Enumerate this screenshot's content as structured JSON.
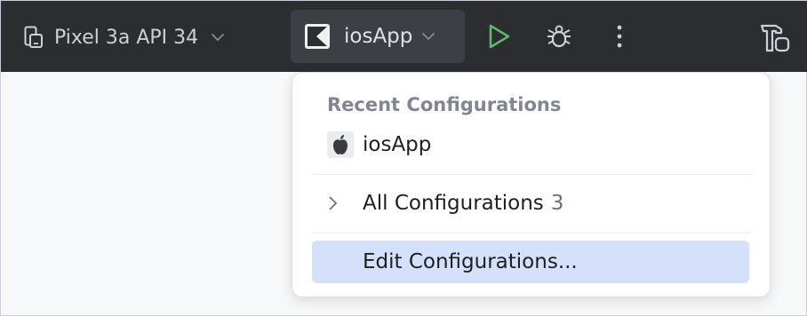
{
  "toolbar": {
    "device": {
      "label": "Pixel 3a API 34",
      "icon": "device-icon",
      "dropdown_icon": "chevron-down-icon"
    },
    "run_config": {
      "label": "iosApp",
      "icon": "kotlin-multiplatform-icon",
      "dropdown_icon": "chevron-down-icon"
    },
    "actions": [
      {
        "name": "run",
        "icon": "run-icon",
        "color": "#5fb865"
      },
      {
        "name": "debug",
        "icon": "debug-icon"
      },
      {
        "name": "more",
        "icon": "more-vertical-icon"
      },
      {
        "name": "build",
        "icon": "hammer-icon"
      }
    ],
    "colors": {
      "background": "#2b2d30",
      "selected": "#3c3f44"
    }
  },
  "popup": {
    "section_title": "Recent Configurations",
    "recent_items": [
      {
        "label": "iosApp",
        "icon": "apple-icon"
      }
    ],
    "all_configurations": {
      "label": "All Configurations",
      "count": "3"
    },
    "edit_configurations": {
      "label": "Edit Configurations...",
      "highlight_color": "#d5e1fb"
    }
  }
}
